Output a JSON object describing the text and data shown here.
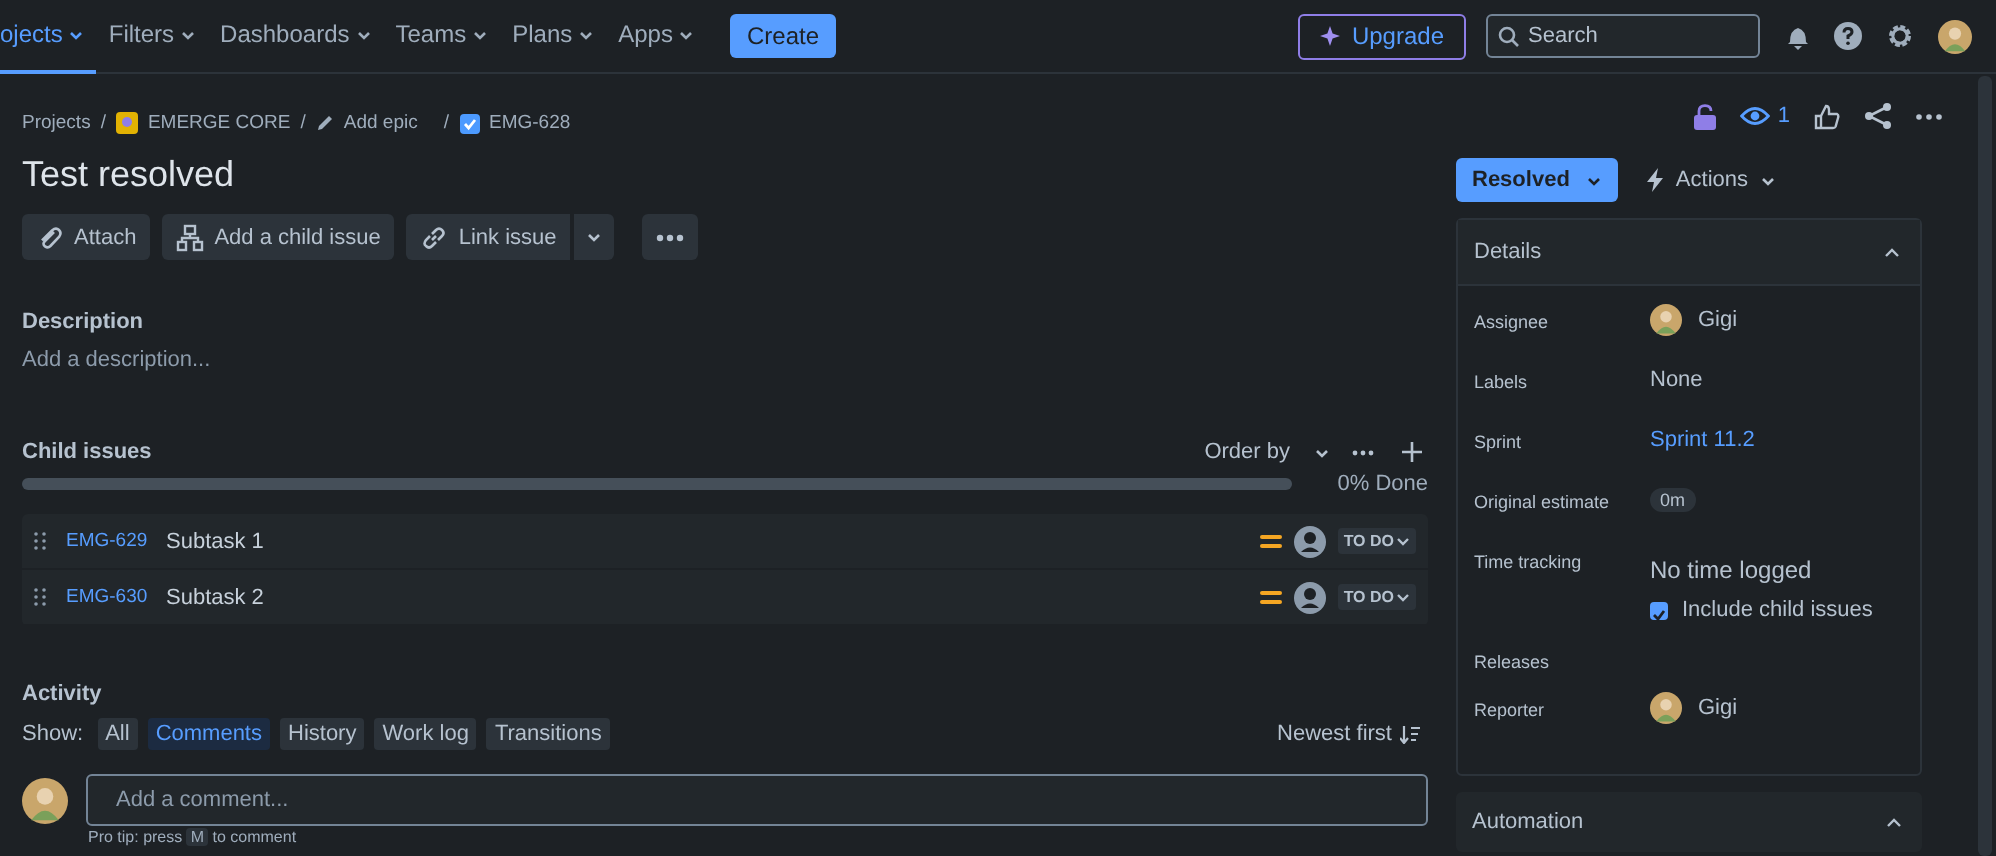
{
  "nav": {
    "items": [
      {
        "label": "ojects",
        "selected": true
      },
      {
        "label": "Filters",
        "selected": false
      },
      {
        "label": "Dashboards",
        "selected": false
      },
      {
        "label": "Teams",
        "selected": false
      },
      {
        "label": "Plans",
        "selected": false
      },
      {
        "label": "Apps",
        "selected": false
      }
    ],
    "create": "Create",
    "upgrade": "Upgrade",
    "search": {
      "placeholder": "Search"
    }
  },
  "breadcrumbs": [
    {
      "kind": "text",
      "label": "Projects",
      "separator": "/"
    },
    {
      "kind": "project",
      "label": "EMERGE CORE",
      "separator": "/"
    },
    {
      "kind": "epic",
      "label": "Add epic",
      "separator": "/"
    },
    {
      "kind": "issue",
      "label": "EMG-628"
    }
  ],
  "title": "Test resolved",
  "toolbar": [
    {
      "kind": "attach",
      "label": "Attach"
    },
    {
      "kind": "child",
      "label": "Add a child issue"
    },
    {
      "kind": "link",
      "label": "Link issue"
    }
  ],
  "description": {
    "heading": "Description",
    "placeholder": "Add a description..."
  },
  "child_issues": {
    "heading": "Child issues",
    "order_by": "Order by",
    "progress": {
      "level": 0,
      "label": "0% Done"
    },
    "rows": [
      {
        "key": "EMG-629",
        "summary": "Subtask 1",
        "status": "TO DO"
      },
      {
        "key": "EMG-630",
        "summary": "Subtask 2",
        "status": "TO DO"
      }
    ]
  },
  "activity": {
    "heading": "Activity",
    "show_label": "Show:",
    "filters": [
      {
        "label": "All",
        "selected": false
      },
      {
        "label": "Comments",
        "selected": true
      },
      {
        "label": "History",
        "selected": false
      },
      {
        "label": "Work log",
        "selected": false
      },
      {
        "label": "Transitions",
        "selected": false
      }
    ],
    "sort": "Newest first"
  },
  "comment": {
    "placeholder": "Add a comment...",
    "tip": "Pro tip: press",
    "tip_key": "M",
    "tip_after": "to comment"
  },
  "watchers": "1",
  "status": "Resolved",
  "actions": "Actions",
  "details": {
    "heading": "Details",
    "fields": [
      {
        "label": "Assignee",
        "kind": "user",
        "value": "Gigi"
      },
      {
        "label": "Labels",
        "kind": "text",
        "value": "None"
      },
      {
        "label": "Sprint",
        "kind": "link",
        "value": "Sprint 11.2"
      },
      {
        "label": "Original estimate",
        "kind": "chip",
        "value": "0m"
      },
      {
        "label": "Time tracking",
        "kind": "tracking",
        "value": "No time logged",
        "option": "Include child issues",
        "checked": true
      },
      {
        "label": "Releases",
        "kind": "empty"
      },
      {
        "label": "Reporter",
        "kind": "user",
        "value": "Gigi"
      }
    ]
  },
  "automation": {
    "heading": "Automation"
  }
}
